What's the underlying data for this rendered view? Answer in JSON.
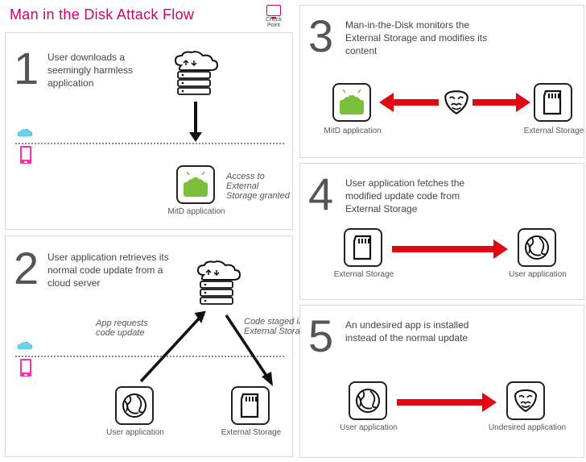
{
  "title": "Man in the Disk Attack Flow",
  "brand": "Check Point",
  "steps": {
    "1": {
      "num": "1",
      "text": "User downloads a seemingly harmless application"
    },
    "2": {
      "num": "2",
      "text": "User application retrieves its normal code update from a cloud server"
    },
    "3": {
      "num": "3",
      "text": "Man-in-the-Disk monitors the External Storage and modifies its content"
    },
    "4": {
      "num": "4",
      "text": "User application fetches the modified update code from External Storage"
    },
    "5": {
      "num": "5",
      "text": "An undesired app is installed instead of the normal update"
    }
  },
  "labels": {
    "mitd_app": "MitD application",
    "user_app": "User application",
    "ext_storage": "External Storage",
    "undesired_app": "Undesired application",
    "access_granted": "Access to External Storage granted",
    "app_requests": "App requests code update",
    "code_staged": "Code staged in External Storage"
  },
  "colors": {
    "accent": "#d0006f",
    "android": "#7bbf3c",
    "arrow_red": "#e30613",
    "gray": "#555"
  }
}
